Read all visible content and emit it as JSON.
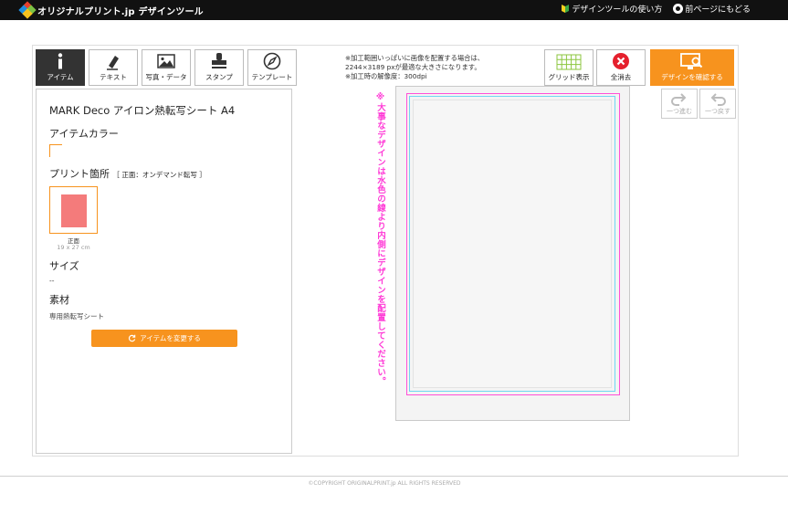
{
  "header": {
    "logo_text": "オリジナルプリント.jp デザインツール",
    "links": [
      {
        "label": "デザインツールの使い方",
        "icon": "beginner-leaf-icon"
      },
      {
        "label": "前ページにもどる",
        "icon": "back-circle-icon"
      }
    ]
  },
  "tool_tabs": [
    {
      "label": "アイテム",
      "icon": "info-icon",
      "active": true
    },
    {
      "label": "テキスト",
      "icon": "pen-icon",
      "active": false
    },
    {
      "label": "写真・データ",
      "icon": "image-icon",
      "active": false
    },
    {
      "label": "スタンプ",
      "icon": "stamp-icon",
      "active": false
    },
    {
      "label": "テンプレート",
      "icon": "compass-icon",
      "active": false
    }
  ],
  "item_panel": {
    "item_name": "MARK Deco アイロン熱転写シート A4",
    "color_label": "アイテムカラー",
    "print_label": "プリント箇所",
    "print_sub": "［ 正面：オンデマンド転写 ］",
    "print_position": {
      "name": "正面",
      "size": "19 x 27 cm"
    },
    "size_label": "サイズ",
    "size_value": "--",
    "material_label": "素材",
    "material_value": "専用熱転写シート",
    "change_button": "アイテムを変更する"
  },
  "notice": {
    "line1": "※加工範囲いっぱいに画像を配置する場合は、",
    "line2": "2244×3189 pxが最適な大きさになります。",
    "line3": "※加工時の解像度：300dpi"
  },
  "toolbar": {
    "grid_label": "グリッド表示",
    "clear_label": "全消去",
    "confirm_label": "デザインを確認する",
    "redo_label": "一つ進む",
    "undo_label": "一つ戻す"
  },
  "canvas": {
    "vertical_note": "※大事なデザインは水色の線より内側にデザインを配置してください。"
  },
  "footer": {
    "copyright": "©COPYRIGHT ORIGINALPRINT.jp ALL RIGHTS RESERVED"
  },
  "colors": {
    "accent": "#f7931e",
    "clear_red": "#e5202d",
    "guide_magenta": "#ff4fd8",
    "guide_cyan": "#6fd6f2",
    "print_area": "#f47b7b"
  }
}
